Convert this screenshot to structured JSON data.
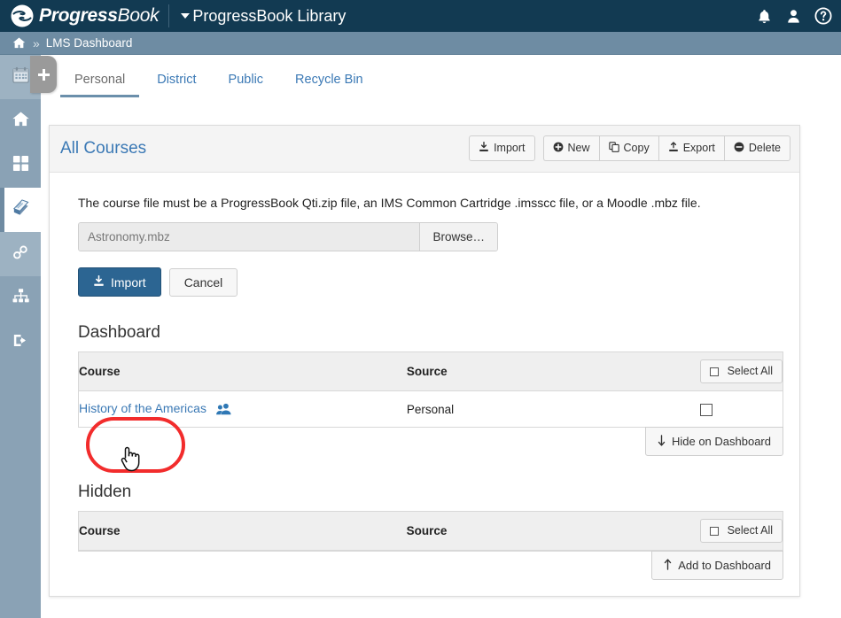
{
  "topbar": {
    "brand_bold": "Progress",
    "brand_thin": "Book",
    "app_title": "ProgressBook Library",
    "icons": [
      {
        "name": "notifications-icon",
        "label": "bell-icon"
      },
      {
        "name": "user-account-icon",
        "label": "user-icon"
      },
      {
        "name": "help-icon",
        "label": "question-circle-icon"
      }
    ],
    "colors": {
      "bar": "#123a52",
      "text": "#ffffff"
    }
  },
  "breadcrumb": {
    "home_icon": "home-icon",
    "separator": "»",
    "current": "LMS Dashboard",
    "color": "#6e8ca3"
  },
  "sidebar": {
    "plus_tab_label": "+",
    "items": [
      {
        "name": "calendar",
        "icon": "calendar-icon",
        "state": "soft"
      },
      {
        "name": "home",
        "icon": "home-icon",
        "state": "normal"
      },
      {
        "name": "apps",
        "icon": "grid-icon",
        "state": "normal"
      },
      {
        "name": "library",
        "icon": "book-icon",
        "state": "active"
      },
      {
        "name": "links",
        "icon": "chain-link-icon",
        "state": "soft"
      },
      {
        "name": "org-chart",
        "icon": "sitemap-icon",
        "state": "normal"
      },
      {
        "name": "sign-out",
        "icon": "logout-icon",
        "state": "normal"
      }
    ]
  },
  "tabs": [
    {
      "label": "Personal",
      "active": true
    },
    {
      "label": "District",
      "active": false
    },
    {
      "label": "Public",
      "active": false
    },
    {
      "label": "Recycle Bin",
      "active": false
    }
  ],
  "card": {
    "title": "All Courses",
    "actions": {
      "import": "Import",
      "group": [
        {
          "label": "New",
          "icon": "plus-circle-icon"
        },
        {
          "label": "Copy",
          "icon": "copy-icon"
        },
        {
          "label": "Export",
          "icon": "upload-icon"
        },
        {
          "label": "Delete",
          "icon": "minus-circle-icon"
        }
      ]
    },
    "helper_text": "The course file must be a ProgressBook Qti.zip file, an IMS Common Cartridge .imsscc file, or a Moodle .mbz file.",
    "file_input": {
      "value": "Astronomy.mbz",
      "placeholder": "Astronomy.mbz",
      "browse_label": "Browse…"
    },
    "import_button": "Import",
    "cancel_button": "Cancel",
    "annotation_color": "#f22c2c"
  },
  "dashboard_section": {
    "title": "Dashboard",
    "columns": [
      "Course",
      "Source"
    ],
    "select_all_label": "Select All",
    "rows": [
      {
        "course": "History of the Americas",
        "shared_icon": "users-icon",
        "source": "Personal",
        "checked": false
      }
    ],
    "footer_button": "Hide on Dashboard",
    "footer_icon": "arrow-down-icon"
  },
  "hidden_section": {
    "title": "Hidden",
    "columns": [
      "Course",
      "Source"
    ],
    "select_all_label": "Select All",
    "rows": [],
    "footer_button": "Add to Dashboard",
    "footer_icon": "arrow-up-icon"
  }
}
